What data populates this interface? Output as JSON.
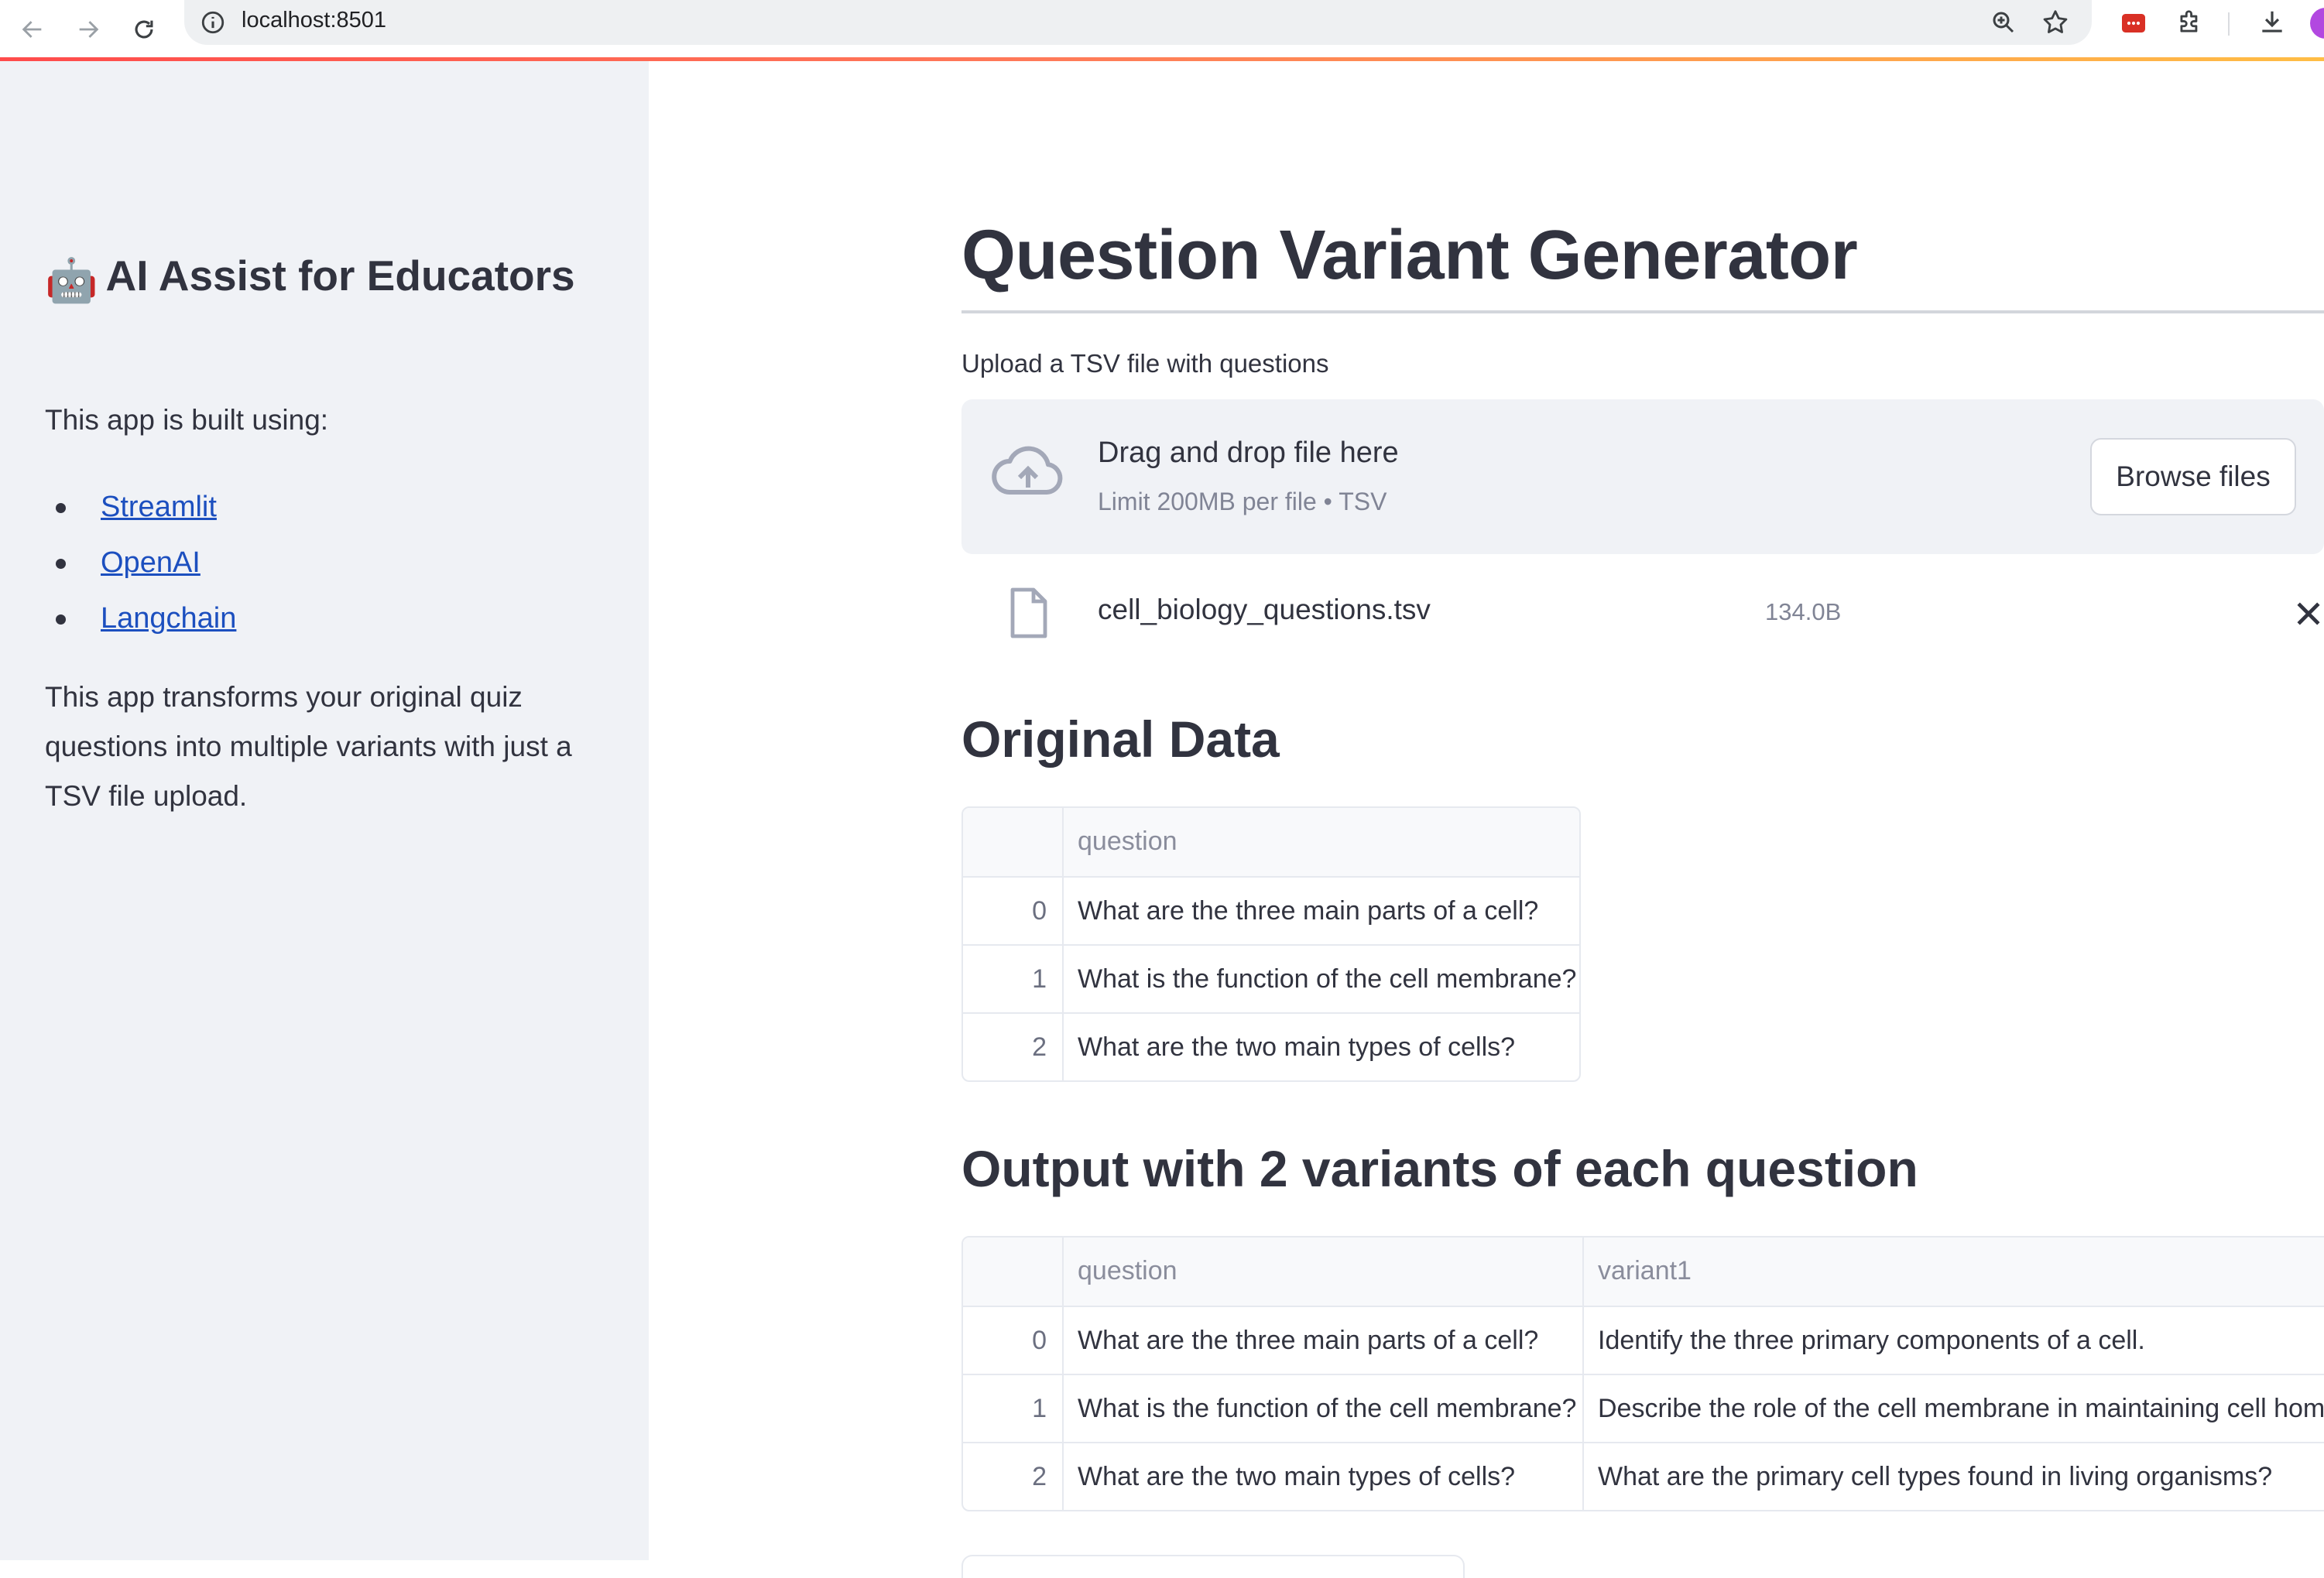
{
  "browser": {
    "url": "localhost:8501",
    "icons": [
      "back-icon",
      "forward-icon",
      "reload-icon",
      "site-info-icon",
      "zoom-icon",
      "bookmark-star-icon",
      "extension-icon",
      "puzzle-icon",
      "download-icon",
      "profile-avatar"
    ]
  },
  "colors": {
    "accent_gradient": [
      "#ff4b4b",
      "#ff7a59",
      "#ffbd45"
    ],
    "sidebar_bg": "#f0f2f6",
    "link": "#1c4fbf",
    "text": "#31333f"
  },
  "sidebar": {
    "title_emoji": "🤖",
    "title": "AI Assist for Educators",
    "built_using": "This app is built using:",
    "links": [
      {
        "label": "Streamlit"
      },
      {
        "label": "OpenAI"
      },
      {
        "label": "Langchain"
      }
    ],
    "description": "This app transforms your original quiz questions into multiple variants with just a TSV file upload."
  },
  "main": {
    "title": "Question Variant Generator",
    "uploader": {
      "label": "Upload a TSV file with questions",
      "drop_title": "Drag and drop file here",
      "limit": "Limit 200MB per file • TSV",
      "browse_button": "Browse files"
    },
    "uploaded_file": {
      "name": "cell_biology_questions.tsv",
      "size": "134.0B"
    },
    "original_heading": "Original Data",
    "original_table": {
      "columns": [
        "",
        "question"
      ],
      "rows": [
        {
          "index": "0",
          "question": "What are the three main parts of a cell?"
        },
        {
          "index": "1",
          "question": "What is the function of the cell membrane?"
        },
        {
          "index": "2",
          "question": "What are the two main types of cells?"
        }
      ]
    },
    "output_heading": "Output with 2 variants of each question",
    "output_table": {
      "columns": [
        "",
        "question",
        "variant1"
      ],
      "rows": [
        {
          "index": "0",
          "question": "What are the three main parts of a cell?",
          "variant1": "Identify the three primary components of a cell."
        },
        {
          "index": "1",
          "question": "What is the function of the cell membrane?",
          "variant1": "Describe the role of the cell membrane in maintaining cell homeo"
        },
        {
          "index": "2",
          "question": "What are the two main types of cells?",
          "variant1": "What are the primary cell types found in living organisms?"
        }
      ]
    }
  }
}
